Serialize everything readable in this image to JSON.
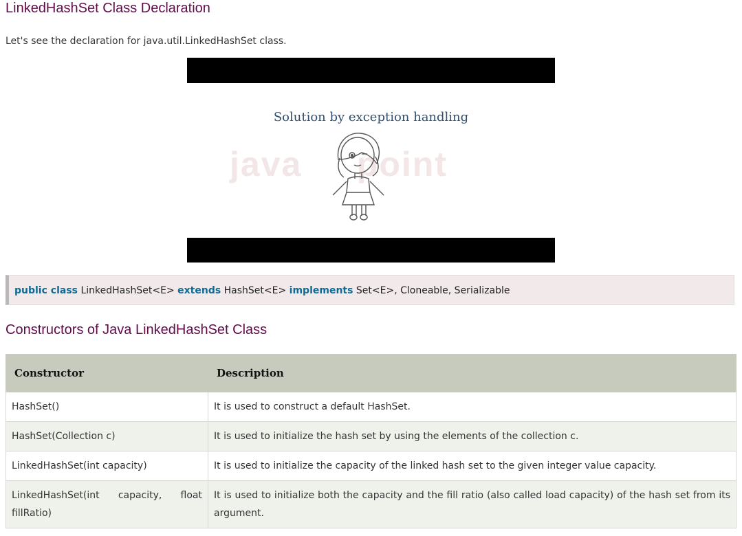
{
  "heading": "LinkedHashSet Class Declaration",
  "intro": "Let's see the declaration for java.util.LinkedHashSet class.",
  "video": {
    "caption": "Solution by exception handling",
    "watermark": "javaTpoint"
  },
  "declaration": {
    "kw1": "public class",
    "part1": " LinkedHashSet<E> ",
    "kw2": "extends",
    "part2": " HashSet<E> ",
    "kw3": "implements",
    "part3": " Set<E>, Cloneable, Serializable"
  },
  "constructors_heading": "Constructors of Java LinkedHashSet Class",
  "table": {
    "headers": [
      "Constructor",
      "Description"
    ],
    "rows": [
      [
        "HashSet()",
        "It is used to construct a default HashSet."
      ],
      [
        "HashSet(Collection c)",
        "It is used to initialize the hash set by using the elements of the collection c."
      ],
      [
        "LinkedHashSet(int capacity)",
        "It is used to initialize the capacity of the linked hash set to the given integer value capacity."
      ],
      [
        "LinkedHashSet(int capacity, float fillRatio)",
        "It is used to initialize both the capacity and the fill ratio (also called load capacity) of the hash set from its argument."
      ]
    ]
  }
}
